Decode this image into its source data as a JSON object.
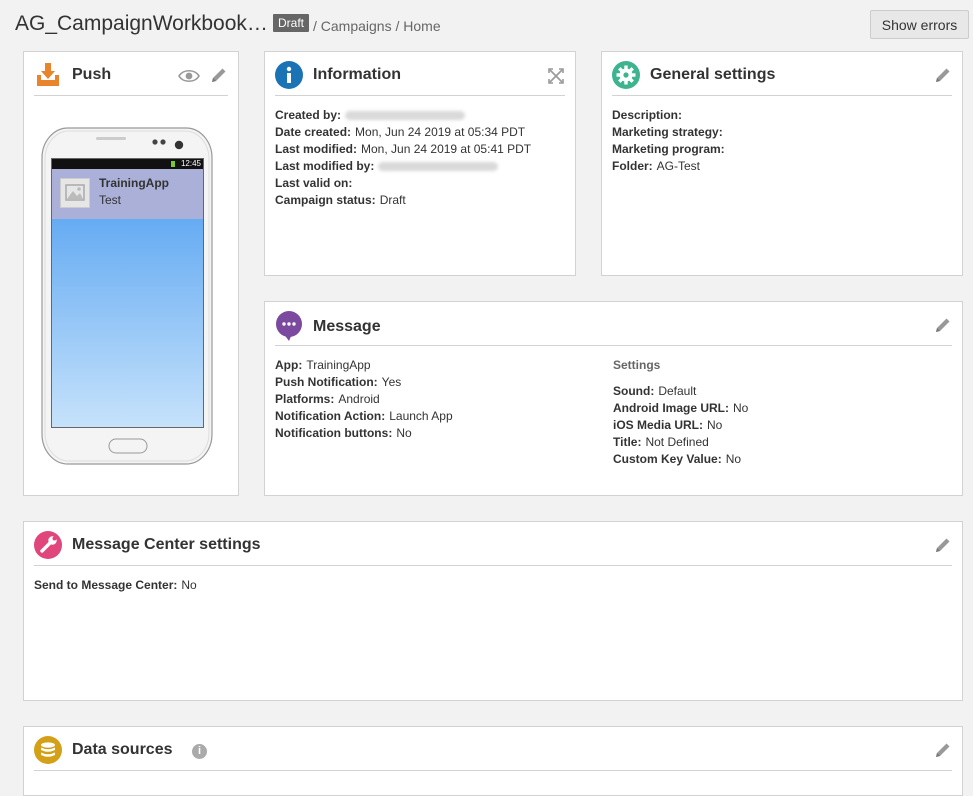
{
  "header": {
    "title": "AG_CampaignWorkbook…",
    "status_badge": "Draft",
    "breadcrumb": [
      {
        "label": "Campaigns"
      },
      {
        "label": "Home"
      }
    ],
    "show_errors_label": "Show errors"
  },
  "push": {
    "title": "Push",
    "phone_time": "12:45",
    "notification_title": "TrainingApp",
    "notification_text": "Test"
  },
  "information": {
    "title": "Information",
    "fields": [
      {
        "label": "Created by:",
        "value": ""
      },
      {
        "label": "Date created:",
        "value": "Mon, Jun 24 2019 at 05:34 PDT"
      },
      {
        "label": "Last modified:",
        "value": "Mon, Jun 24 2019 at 05:41 PDT"
      },
      {
        "label": "Last modified by:",
        "value": ""
      },
      {
        "label": "Last valid on:",
        "value": ""
      },
      {
        "label": "Campaign status:",
        "value": "Draft"
      }
    ]
  },
  "general_settings": {
    "title": "General settings",
    "fields": [
      {
        "label": "Description:",
        "value": ""
      },
      {
        "label": "Marketing strategy:",
        "value": ""
      },
      {
        "label": "Marketing program:",
        "value": ""
      },
      {
        "label": "Folder:",
        "value": "AG-Test"
      }
    ]
  },
  "message": {
    "title": "Message",
    "left_fields": [
      {
        "label": "App:",
        "value": "TrainingApp"
      },
      {
        "label": "Push Notification:",
        "value": "Yes"
      },
      {
        "label": "Platforms:",
        "value": "Android"
      },
      {
        "label": "Notification Action:",
        "value": "Launch App"
      },
      {
        "label": "Notification buttons:",
        "value": "No"
      }
    ],
    "settings_heading": "Settings",
    "right_fields": [
      {
        "label": "Sound:",
        "value": "Default"
      },
      {
        "label": "Android Image URL:",
        "value": "No"
      },
      {
        "label": "iOS Media URL:",
        "value": "No"
      },
      {
        "label": "Title:",
        "value": "Not Defined"
      },
      {
        "label": "Custom Key Value:",
        "value": "No"
      }
    ]
  },
  "message_center": {
    "title": "Message Center settings",
    "fields": [
      {
        "label": "Send to Message Center:",
        "value": "No"
      }
    ]
  },
  "data_sources": {
    "title": "Data sources",
    "info_glyph": "i"
  },
  "colors": {
    "info_icon": "#1a73b5",
    "settings_icon": "#3db38f",
    "message_icon": "#7b4a9e",
    "message_center_icon": "#e0457b",
    "data_sources_icon": "#d4a017",
    "push_icon": "#e8842c",
    "notification_bg": "#aab0d8",
    "screen_gradient_top": "#4a9cf0",
    "screen_gradient_bottom": "#c6e2fb"
  },
  "icons": {
    "push": "download-tray-icon",
    "preview": "eye-icon",
    "edit": "pencil-icon",
    "expand": "expand-arrows-icon",
    "information": "info-icon",
    "general_settings": "gear-icon",
    "message": "chat-bubble-icon",
    "message_center": "wrench-icon",
    "data_sources": "database-icon"
  }
}
